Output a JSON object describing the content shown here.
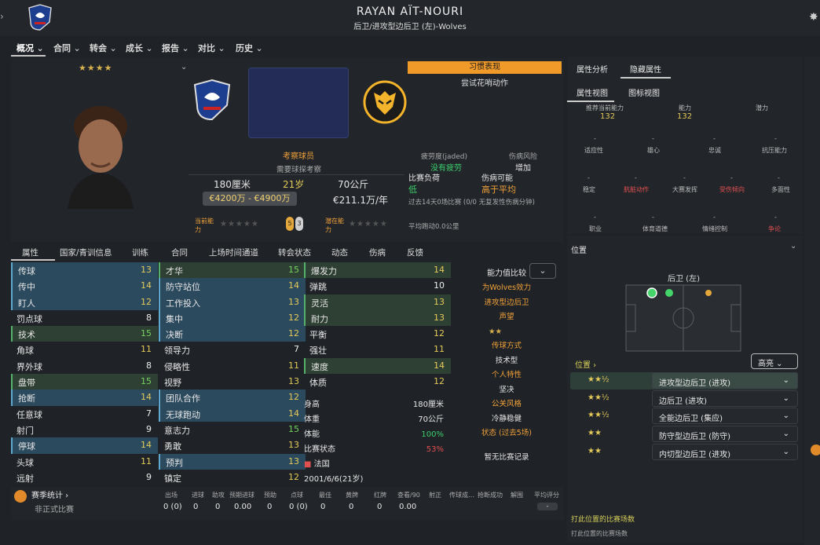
{
  "header": {
    "player_name": "RAYAN AÏT-NOURI",
    "subtitle": "后卫/进攻型边后卫 (左)-Wolves",
    "menu": [
      "概况",
      "合同",
      "转会",
      "成长",
      "报告",
      "对比",
      "历史"
    ]
  },
  "profile": {
    "stars": "★★★★",
    "scout": "考察球员",
    "needs": "需要球探考察",
    "height": "180厘米",
    "age": "21岁",
    "weight": "70公斤",
    "value": "€4200万 - €4900万",
    "wage": "€211.1万/年",
    "current_ability": "当前能力",
    "potential": "潜在能力",
    "ca_badge_a": "5",
    "ca_badge_b": "3"
  },
  "habit": {
    "title": "习惯表现",
    "text": "尝试花哨动作"
  },
  "status": {
    "fatigue_label": "疲劳度(jaded)",
    "fatigue_value": "没有疲劳",
    "injury_risk_label": "伤病风险",
    "injury_risk_value": "增加",
    "match_load_label": "比赛负荷",
    "match_load_value": "低",
    "injury_chance_label": "伤病可能",
    "injury_chance_value": "高于平均",
    "last14": "过去14天0场比赛 (0/0 无复发性伤病分钟)",
    "avg_run": "平均跑动0.0公里"
  },
  "tabs": [
    "属性",
    "国家/青训信息",
    "训练",
    "合同",
    "上场时间通道",
    "转会状态",
    "动态",
    "伤病",
    "反馈"
  ],
  "tech": [
    [
      "传球",
      "13"
    ],
    [
      "传中",
      "14"
    ],
    [
      "盯人",
      "12"
    ],
    [
      "罚点球",
      "8"
    ],
    [
      "技术",
      "15"
    ],
    [
      "角球",
      "11"
    ],
    [
      "界外球",
      "8"
    ],
    [
      "盘带",
      "15"
    ],
    [
      "抢断",
      "14"
    ],
    [
      "任意球",
      "7"
    ],
    [
      "射门",
      "9"
    ],
    [
      "停球",
      "14"
    ],
    [
      "头球",
      "11"
    ],
    [
      "远射",
      "9"
    ]
  ],
  "mental": [
    [
      "才华",
      "15"
    ],
    [
      "防守站位",
      "14"
    ],
    [
      "工作投入",
      "13"
    ],
    [
      "集中",
      "12"
    ],
    [
      "决断",
      "12"
    ],
    [
      "领导力",
      "7"
    ],
    [
      "侵略性",
      "11"
    ],
    [
      "视野",
      "13"
    ],
    [
      "团队合作",
      "12"
    ],
    [
      "无球跑动",
      "14"
    ],
    [
      "意志力",
      "15"
    ],
    [
      "勇敢",
      "13"
    ],
    [
      "预判",
      "13"
    ],
    [
      "镇定",
      "12"
    ]
  ],
  "physical": [
    [
      "爆发力",
      "14"
    ],
    [
      "弹跳",
      "10"
    ],
    [
      "灵活",
      "13"
    ],
    [
      "耐力",
      "13"
    ],
    [
      "平衡",
      "12"
    ],
    [
      "强壮",
      "11"
    ],
    [
      "速度",
      "14"
    ],
    [
      "体质",
      "12"
    ]
  ],
  "body": {
    "height_label": "身高",
    "height": "180厘米",
    "weight_label": "体重",
    "weight": "70公斤",
    "fitness_label": "体能",
    "fitness": "100%",
    "form_label": "比赛状态",
    "form": "53%",
    "nation": "法国",
    "dob": "2001/6/6(21岁)"
  },
  "compare": {
    "title": "能力值比较",
    "items": [
      "为Wolves效力",
      "进攻型边后卫",
      "声望",
      "★★",
      "传球方式",
      "技术型",
      "个人特性",
      "坚决",
      "公关风格",
      "冷静稳健",
      "状态 (过去5场)",
      "暂无比赛记录"
    ]
  },
  "season": {
    "title": "赛季统计",
    "row_label": "非正式比赛",
    "cols": [
      "出场",
      "进球",
      "助攻",
      "预期进球",
      "预助",
      "点球",
      "最佳",
      "黄牌",
      "红牌",
      "查看/90",
      "射正",
      "传球成…",
      "抢断成功",
      "解围",
      "平均评分"
    ],
    "vals": [
      "0 (0)",
      "0",
      "0",
      "0.00",
      "0",
      "0 (0)",
      "0",
      "0",
      "0",
      "0.00",
      "",
      "",
      "",
      "",
      "-"
    ]
  },
  "right": {
    "tabs": [
      "属性分析",
      "隐藏属性"
    ],
    "subtabs": [
      "属性视图",
      "图标视图"
    ],
    "hidden_attrs": [
      [
        "推荐当前能力",
        "132"
      ],
      [
        "能力",
        "132"
      ],
      [
        "潜力",
        ""
      ]
    ],
    "hidden_rows": [
      [
        "适应性",
        "雄心",
        "忠诚",
        "抗压能力"
      ],
      [
        "稳定",
        "肮脏动作",
        "大赛发挥",
        "受伤倾向",
        "多面性"
      ],
      [
        "职业",
        "体育道德",
        "情绪控制",
        "争论"
      ]
    ],
    "position_title": "位置",
    "position_label": "后卫 (左)",
    "pos_btn": "位置 ›",
    "highlight": "高亮",
    "positions": [
      [
        "★★½",
        "进攻型边后卫 (进攻)"
      ],
      [
        "★★½",
        "边后卫 (进攻)"
      ],
      [
        "★★½",
        "全能边后卫 (集应)"
      ],
      [
        "★★",
        "防守型边后卫 (防守)"
      ],
      [
        "★★",
        "内切型边后卫 (进攻)"
      ]
    ],
    "footer1": "打此位置的比赛场数",
    "footer2": "打此位置的比赛场数"
  },
  "colors": {
    "accent": "#f09a2a",
    "green": "#3ccf6c",
    "yellow": "#e3c95a"
  }
}
